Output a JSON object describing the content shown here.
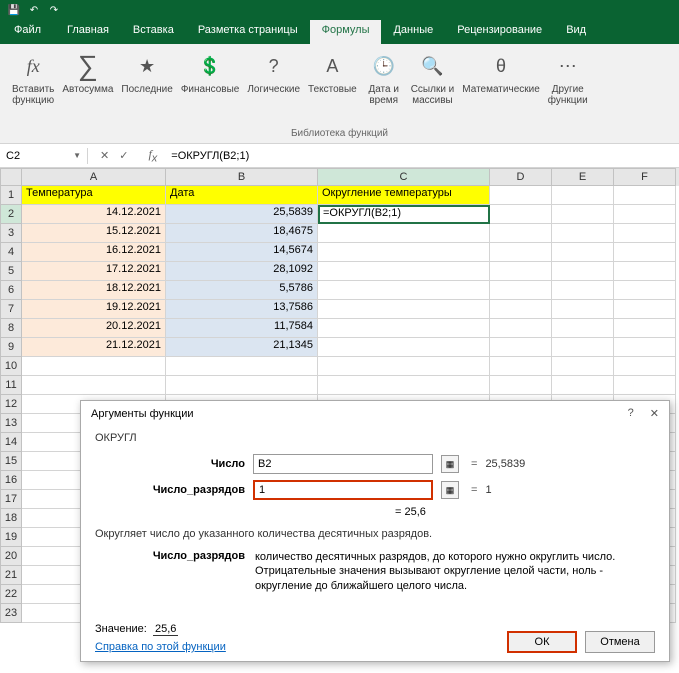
{
  "titlebar": {
    "save": "💾",
    "undo": "↶",
    "redo": "↷"
  },
  "tabs": {
    "file": "Файл",
    "home": "Главная",
    "insert": "Вставка",
    "layout": "Разметка страницы",
    "formulas": "Формулы",
    "data": "Данные",
    "review": "Рецензирование",
    "view": "Вид"
  },
  "ribbon": {
    "insert_fn": {
      "label": "Вставить\nфункцию",
      "icon": "fx"
    },
    "autosum": {
      "label": "Автосумма",
      "icon": "∑"
    },
    "recent": {
      "label": "Последние",
      "icon": "★"
    },
    "financial": {
      "label": "Финансовые",
      "icon": "💲"
    },
    "logical": {
      "label": "Логические",
      "icon": "?"
    },
    "text": {
      "label": "Текстовые",
      "icon": "A"
    },
    "datetime": {
      "label": "Дата и\nвремя",
      "icon": "🕒"
    },
    "lookup": {
      "label": "Ссылки и\nмассивы",
      "icon": "🔍"
    },
    "math": {
      "label": "Математические",
      "icon": "θ"
    },
    "more": {
      "label": "Другие\nфункции",
      "icon": "⋯"
    },
    "group_label": "Библиотека функций"
  },
  "namebox": "C2",
  "formula": "=ОКРУГЛ(B2;1)",
  "cols": {
    "A": "A",
    "B": "B",
    "C": "C",
    "D": "D",
    "E": "E",
    "F": "F"
  },
  "headers": {
    "A": "Температура",
    "B": "Дата",
    "C": "Округление температуры"
  },
  "rows": [
    {
      "n": "1"
    },
    {
      "n": "2",
      "A": "14.12.2021",
      "B": "25,5839",
      "C": "=ОКРУГЛ(B2;1)"
    },
    {
      "n": "3",
      "A": "15.12.2021",
      "B": "18,4675"
    },
    {
      "n": "4",
      "A": "16.12.2021",
      "B": "14,5674"
    },
    {
      "n": "5",
      "A": "17.12.2021",
      "B": "28,1092"
    },
    {
      "n": "6",
      "A": "18.12.2021",
      "B": "5,5786"
    },
    {
      "n": "7",
      "A": "19.12.2021",
      "B": "13,7586"
    },
    {
      "n": "8",
      "A": "20.12.2021",
      "B": "11,7584"
    },
    {
      "n": "9",
      "A": "21.12.2021",
      "B": "21,1345"
    },
    {
      "n": "10"
    },
    {
      "n": "11"
    },
    {
      "n": "12"
    },
    {
      "n": "13"
    },
    {
      "n": "14"
    },
    {
      "n": "15"
    },
    {
      "n": "16"
    },
    {
      "n": "17"
    },
    {
      "n": "18"
    },
    {
      "n": "19"
    },
    {
      "n": "20"
    },
    {
      "n": "21"
    },
    {
      "n": "22"
    },
    {
      "n": "23"
    }
  ],
  "dialog": {
    "title": "Аргументы функции",
    "fn": "ОКРУГЛ",
    "arg1": {
      "label": "Число",
      "value": "B2",
      "result": "25,5839"
    },
    "arg2": {
      "label": "Число_разрядов",
      "value": "1",
      "result": "1"
    },
    "preview": "25,6",
    "desc": "Округляет число до указанного количества десятичных разрядов.",
    "arg_desc_label": "Число_разрядов",
    "arg_desc": "количество десятичных разрядов, до которого нужно округлить число. Отрицательные значения вызывают округление целой части, ноль - округление до ближайшего целого числа.",
    "value_label": "Значение:",
    "value": "25,6",
    "help": "Справка по этой функции",
    "ok": "ОК",
    "cancel": "Отмена",
    "eq": "="
  }
}
